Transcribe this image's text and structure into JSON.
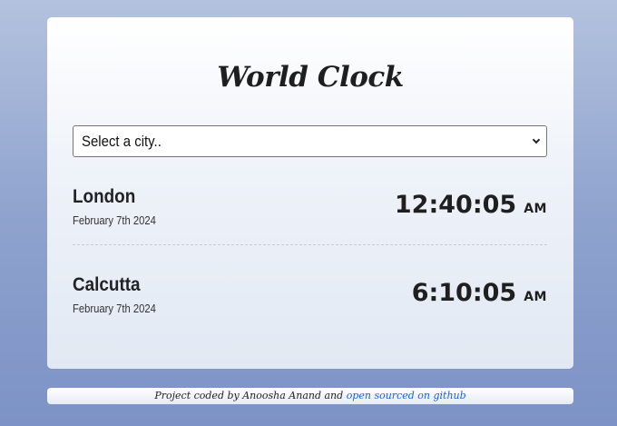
{
  "app": {
    "title": "World Clock"
  },
  "city_select": {
    "selected_label": "Select a city.."
  },
  "cities": [
    {
      "name": "London",
      "date": "February 7th 2024",
      "time": "12:40:05",
      "ampm": "AM"
    },
    {
      "name": "Calcutta",
      "date": "February 7th 2024",
      "time": "6:10:05",
      "ampm": "AM"
    }
  ],
  "footer": {
    "text": "Project coded by Anoosha Anand and",
    "link_text": "open sourced on github"
  },
  "colors": {
    "background_top": "#b3c2de",
    "background_bottom": "#7d92c6",
    "link": "#1a5fd6",
    "text": "#1f1f1f"
  }
}
